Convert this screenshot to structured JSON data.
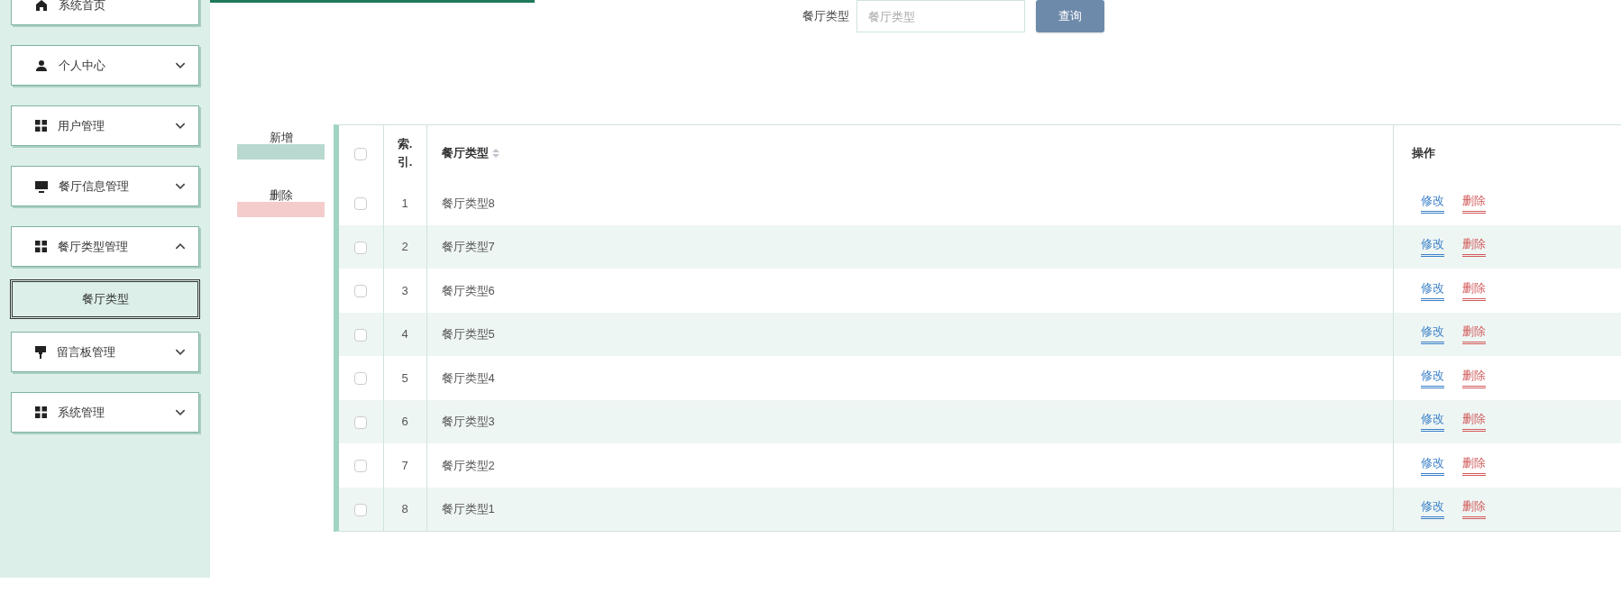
{
  "sidebar": {
    "items": [
      {
        "label": "系统首页",
        "kind": "home"
      },
      {
        "label": "个人中心",
        "kind": "user",
        "expanded": false
      },
      {
        "label": "用户管理",
        "kind": "grid",
        "expanded": false
      },
      {
        "label": "餐厅信息管理",
        "kind": "monitor",
        "expanded": false
      },
      {
        "label": "餐厅类型管理",
        "kind": "grid",
        "expanded": true,
        "children": [
          {
            "label": "餐厅类型",
            "selected": true
          }
        ]
      },
      {
        "label": "留言板管理",
        "kind": "brush",
        "expanded": false
      },
      {
        "label": "系统管理",
        "kind": "grid",
        "expanded": false
      }
    ]
  },
  "search": {
    "label": "餐厅类型",
    "placeholder": "餐厅类型",
    "button": "查询"
  },
  "actions": [
    {
      "label": "新增",
      "kind": "add"
    },
    {
      "label": "删除",
      "kind": "delete"
    }
  ],
  "table": {
    "columns": [
      "索.引.",
      "餐厅类型",
      "操作"
    ],
    "all_checked": false,
    "rows": [
      {
        "index": "1",
        "type": "餐厅类型8",
        "checked": false,
        "edit": "修改",
        "delete": "删除"
      },
      {
        "index": "2",
        "type": "餐厅类型7",
        "checked": false,
        "edit": "修改",
        "delete": "删除"
      },
      {
        "index": "3",
        "type": "餐厅类型6",
        "checked": false,
        "edit": "修改",
        "delete": "删除"
      },
      {
        "index": "4",
        "type": "餐厅类型5",
        "checked": false,
        "edit": "修改",
        "delete": "删除"
      },
      {
        "index": "5",
        "type": "餐厅类型4",
        "checked": false,
        "edit": "修改",
        "delete": "删除"
      },
      {
        "index": "6",
        "type": "餐厅类型3",
        "checked": false,
        "edit": "修改",
        "delete": "删除"
      },
      {
        "index": "7",
        "type": "餐厅类型2",
        "checked": false,
        "edit": "修改",
        "delete": "删除"
      },
      {
        "index": "8",
        "type": "餐厅类型1",
        "checked": false,
        "edit": "修改",
        "delete": "删除"
      }
    ]
  }
}
